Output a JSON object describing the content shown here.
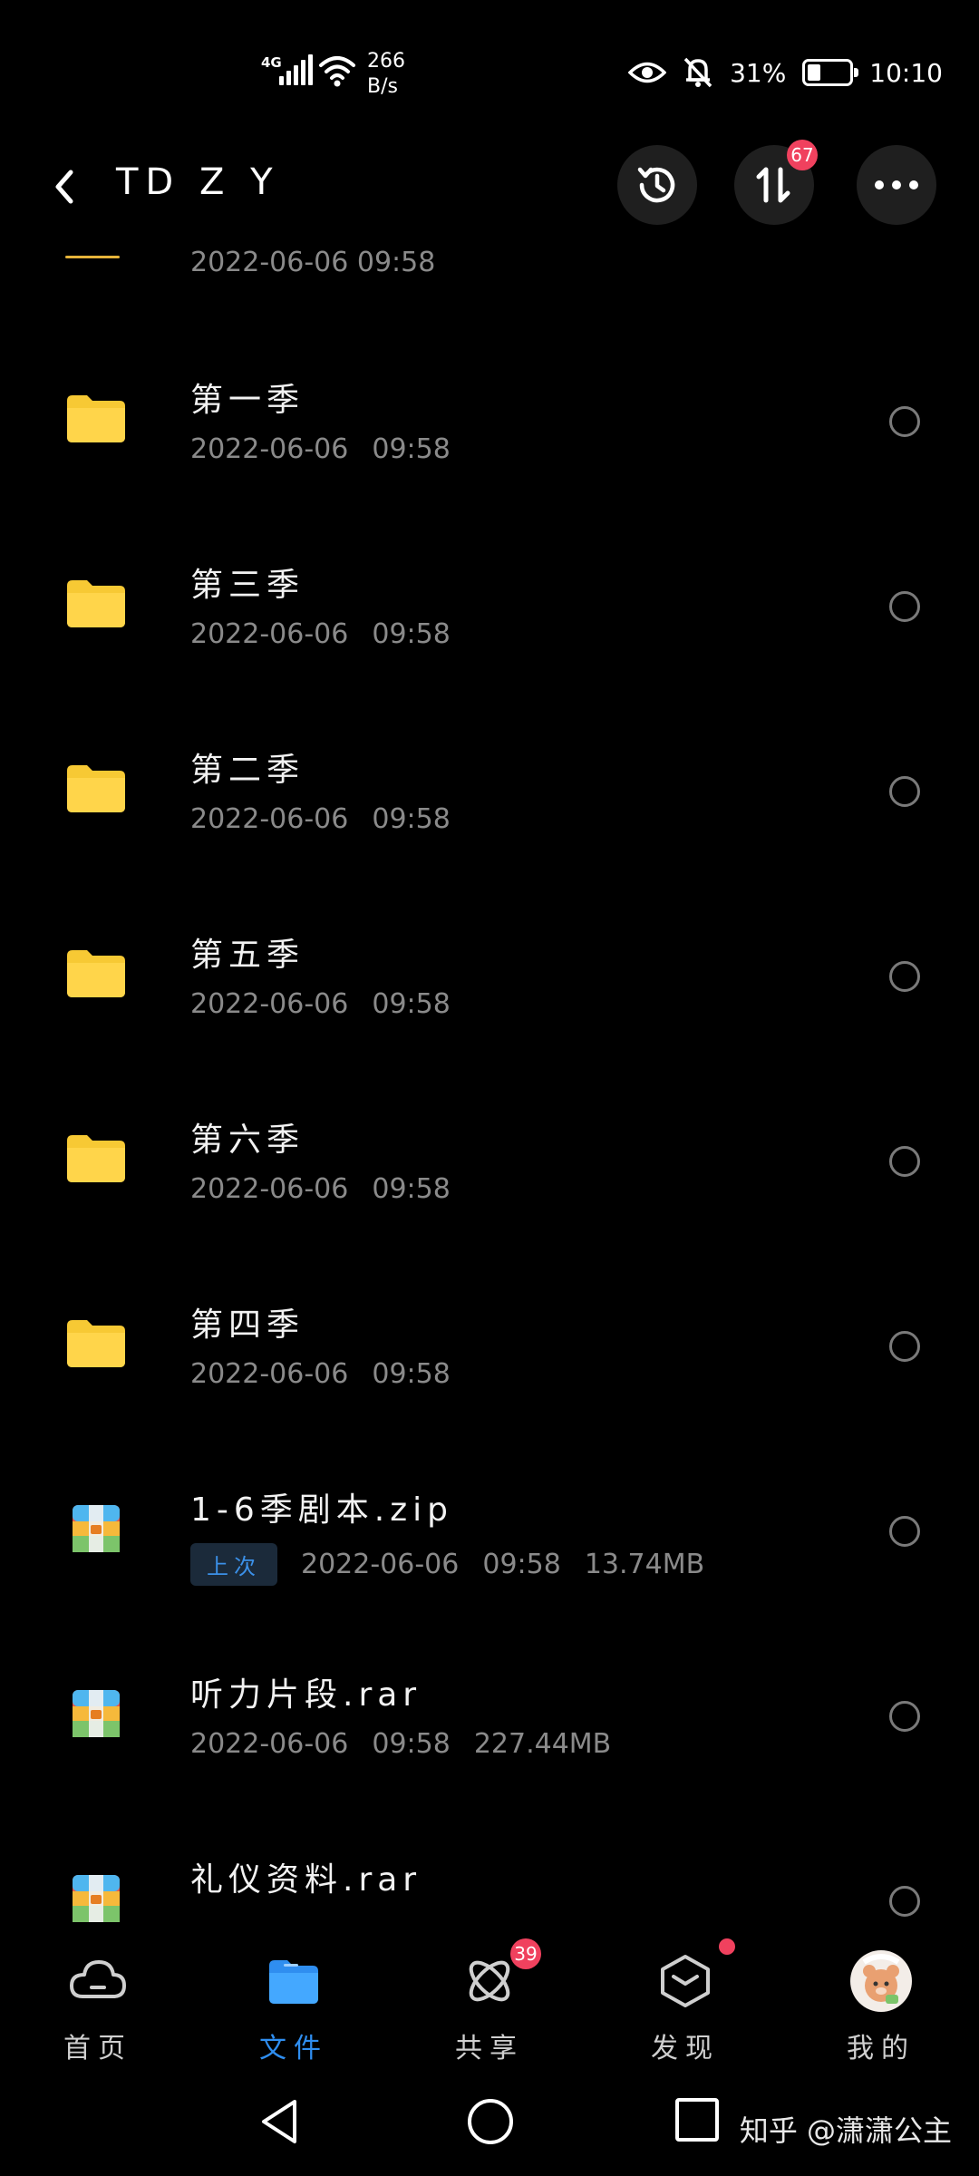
{
  "status_bar": {
    "network_type": "4G",
    "speed_value": "266",
    "speed_unit": "B/s",
    "battery_percent": "31%",
    "battery_level": 0.31,
    "time": "10:10"
  },
  "header": {
    "title": "TD Z Y",
    "transfer_badge": "67"
  },
  "file_list": {
    "partial_item_date": "2022-06-06   09:58",
    "items": [
      {
        "name": "第一季",
        "date": "2022-06-06",
        "time": "09:58",
        "size": "",
        "icon": "folder-icon"
      },
      {
        "name": "第三季",
        "date": "2022-06-06",
        "time": "09:58",
        "size": "",
        "icon": "folder-icon"
      },
      {
        "name": "第二季",
        "date": "2022-06-06",
        "time": "09:58",
        "size": "",
        "icon": "folder-icon"
      },
      {
        "name": "第五季",
        "date": "2022-06-06",
        "time": "09:58",
        "size": "",
        "icon": "folder-icon"
      },
      {
        "name": "第六季",
        "date": "2022-06-06",
        "time": "09:58",
        "size": "",
        "icon": "folder-icon"
      },
      {
        "name": "第四季",
        "date": "2022-06-06",
        "time": "09:58",
        "size": "",
        "icon": "folder-icon"
      },
      {
        "name": "1-6季剧本.zip",
        "tag": "上次",
        "date": "2022-06-06",
        "time": "09:58",
        "size": "13.74MB",
        "icon": "archive-icon"
      },
      {
        "name": "听力片段.rar",
        "date": "2022-06-06",
        "time": "09:58",
        "size": "227.44MB",
        "icon": "archive-icon"
      },
      {
        "name": "礼仪资料.rar",
        "date": "",
        "time": "",
        "size": "",
        "icon": "archive-icon"
      }
    ]
  },
  "bottom_nav": {
    "items": [
      {
        "label": "首页",
        "icon": "cloud-icon"
      },
      {
        "label": "文件",
        "icon": "folder-icon",
        "active": true
      },
      {
        "label": "共享",
        "icon": "atom-icon",
        "badge": "39"
      },
      {
        "label": "发现",
        "icon": "box-icon",
        "dot": true
      },
      {
        "label": "我的",
        "icon": "avatar"
      }
    ]
  },
  "watermark": "知乎 @潇潇公主",
  "colors": {
    "background": "#000000",
    "folder": "#f7c934",
    "accent": "#2f8ef0",
    "badge": "#f0415e"
  }
}
